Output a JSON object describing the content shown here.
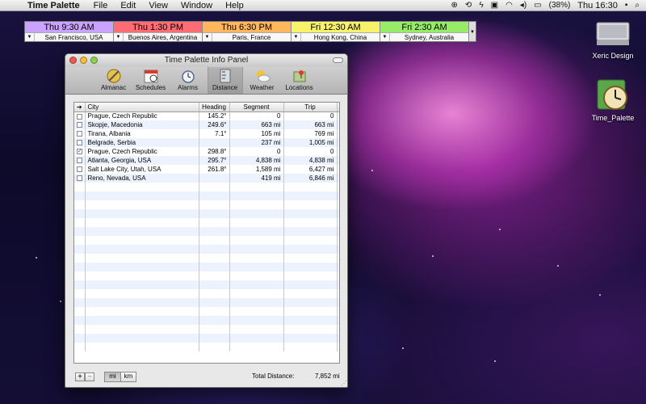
{
  "menubar": {
    "app_name": "Time Palette",
    "menus": [
      "File",
      "Edit",
      "View",
      "Window",
      "Help"
    ],
    "battery": "(38%)",
    "clock": "Thu 16:30"
  },
  "clocks": [
    {
      "time": "Thu 9:30 AM",
      "city": "San Francisco, USA",
      "color": "#c9a3ff"
    },
    {
      "time": "Thu 1:30 PM",
      "city": "Buenos Aires, Argentina",
      "color": "#ff6d74"
    },
    {
      "time": "Thu 6:30 PM",
      "city": "Paris, France",
      "color": "#ffb65c"
    },
    {
      "time": "Fri 12:30 AM",
      "city": "Hong Kong, China",
      "color": "#f7f26a"
    },
    {
      "time": "Fri 2:30 AM",
      "city": "Sydney, Australia",
      "color": "#96ec68"
    }
  ],
  "desktop": {
    "drive_label": "Xeric Design",
    "app_label": "Time_Palette"
  },
  "window": {
    "title": "Time Palette Info Panel",
    "tabs": [
      "Almanac",
      "Schedules",
      "Alarms",
      "Distance",
      "Weather",
      "Locations"
    ],
    "selected_tab": "Distance",
    "columns": [
      "City",
      "Heading",
      "Segment",
      "Trip"
    ],
    "rows": [
      {
        "checked": false,
        "city": "Prague, Czech Republic",
        "heading": "145.2°",
        "segment": "0",
        "trip": "0"
      },
      {
        "checked": false,
        "city": "Skopje, Macedonia",
        "heading": "249.6°",
        "segment": "663 mi",
        "trip": "663 mi"
      },
      {
        "checked": false,
        "city": "Tirana, Albania",
        "heading": "7.1°",
        "segment": "105 mi",
        "trip": "769 mi"
      },
      {
        "checked": false,
        "city": "Belgrade, Serbia",
        "heading": "",
        "segment": "237 mi",
        "trip": "1,005 mi"
      },
      {
        "checked": true,
        "city": "Prague, Czech Republic",
        "heading": "298.8°",
        "segment": "0",
        "trip": "0"
      },
      {
        "checked": false,
        "city": "Atlanta, Georgia, USA",
        "heading": "295.7°",
        "segment": "4,838 mi",
        "trip": "4,838 mi"
      },
      {
        "checked": false,
        "city": "Salt Lake City, Utah, USA",
        "heading": "261.8°",
        "segment": "1,589 mi",
        "trip": "6,427 mi"
      },
      {
        "checked": false,
        "city": "Reno, Nevada, USA",
        "heading": "",
        "segment": "419 mi",
        "trip": "6,846 mi"
      }
    ],
    "add_label": "+",
    "remove_label": "−",
    "unit_mi": "mi",
    "unit_km": "km",
    "total_label": "Total Distance:",
    "total_value": "7,852 mi"
  }
}
